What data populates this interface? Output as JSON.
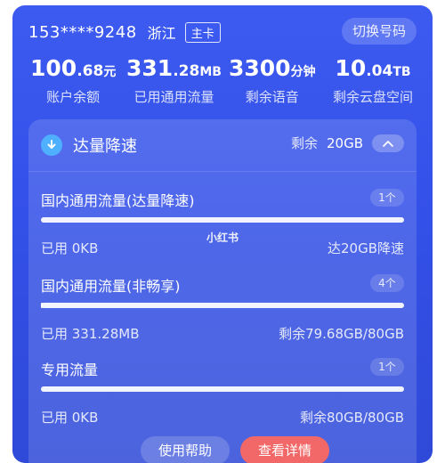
{
  "account": {
    "phone": "153****9248",
    "region": "浙江",
    "card_type": "主卡",
    "switch_label": "切换号码"
  },
  "stats": [
    {
      "int": "100",
      "dec": ".68",
      "unit": "元",
      "label": "账户余额"
    },
    {
      "int": "331",
      "dec": ".28",
      "unit": "MB",
      "label": "已用通用流量"
    },
    {
      "int": "3300",
      "dec": "",
      "unit": "分钟",
      "label": "剩余语音"
    },
    {
      "int": "10",
      "dec": ".04",
      "unit": "TB",
      "label": "剩余云盘空间"
    }
  ],
  "panel": {
    "title": "达量降速",
    "remain_label": "剩余",
    "remain_value": "20GB",
    "packages": [
      {
        "name": "国内通用流量(达量降速)",
        "count": "1个",
        "used": "已用 0KB",
        "right": "达20GB降速",
        "fill": 0.0
      },
      {
        "name": "国内通用流量(非畅享)",
        "count": "4个",
        "used": "已用 331.28MB",
        "right": "剩余79.68GB/80GB",
        "fill": 0.004
      },
      {
        "name": "专用流量",
        "count": "1个",
        "used": "已用 0KB",
        "right": "剩余80GB/80GB",
        "fill": 0.0
      }
    ]
  },
  "watermark": "小红书",
  "buttons": {
    "help": "使用帮助",
    "detail": "查看详情"
  },
  "colors": {
    "bg_top": "#3d5bf0",
    "bg_bottom": "#2f4ad8",
    "accent_button": "#f26868",
    "badge": "#4fb0ff"
  }
}
